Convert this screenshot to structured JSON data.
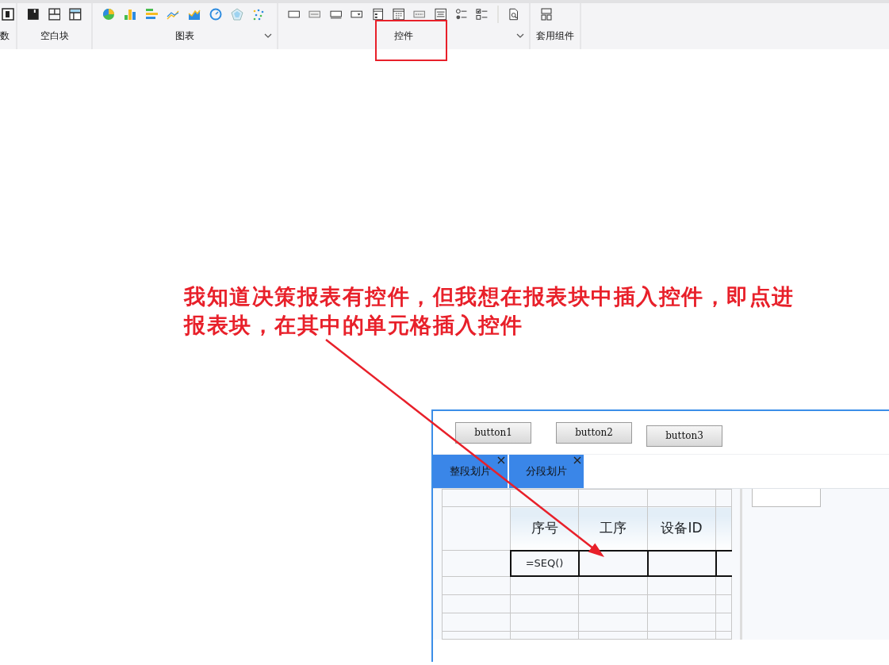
{
  "toolbar": {
    "groups": [
      {
        "kind": "partial",
        "label": "数",
        "expandable": false
      },
      {
        "kind": "blank",
        "label": "空白块",
        "expandable": false
      },
      {
        "kind": "chart",
        "label": "图表",
        "expandable": true
      },
      {
        "kind": "widget",
        "label": "控件",
        "expandable": true,
        "highlighted": true
      },
      {
        "kind": "template",
        "label": "套用组件",
        "expandable": false
      }
    ]
  },
  "annotation": {
    "text": "我知道决策报表有控件，但我想在报表块中插入控件，即点进报表块，在其中的单元格插入控件"
  },
  "form_panel": {
    "buttons": [
      "button1",
      "button2",
      "button3"
    ],
    "tabs": [
      {
        "label": "整段划片",
        "closable": true
      },
      {
        "label": "分段划片",
        "closable": true
      }
    ],
    "table": {
      "columns": [
        "序号",
        "工序",
        "设备ID"
      ],
      "rows": [
        [
          "=SEQ()",
          "",
          ""
        ]
      ]
    }
  }
}
